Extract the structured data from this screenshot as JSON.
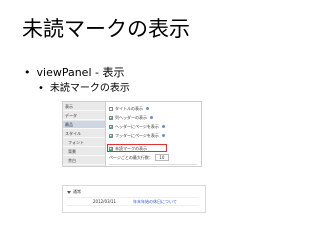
{
  "title": "未読マークの表示",
  "bullets": {
    "level1": "viewPanel - 表示",
    "level2": "未読マークの表示"
  },
  "panel": {
    "sidebar": [
      "表示",
      "データ",
      "最品",
      "スタイル",
      "フォント",
      "背景",
      "余白"
    ],
    "active_index": 2,
    "options": [
      {
        "label": "タイトルの表示",
        "checked": false
      },
      {
        "label": "列ヘッダーの表示",
        "checked": true
      },
      {
        "label": "ヘッダーにページを表示",
        "checked": true
      },
      {
        "label": "フッターにページを表示",
        "checked": true
      },
      {
        "label": "未読マークの表示",
        "checked": true
      }
    ],
    "page_count_label": "ページごとの最大行数：",
    "page_count_value": "10"
  },
  "panel2": {
    "header": "通常",
    "date": "2012/03/11",
    "link": "年末年始の休日について"
  }
}
